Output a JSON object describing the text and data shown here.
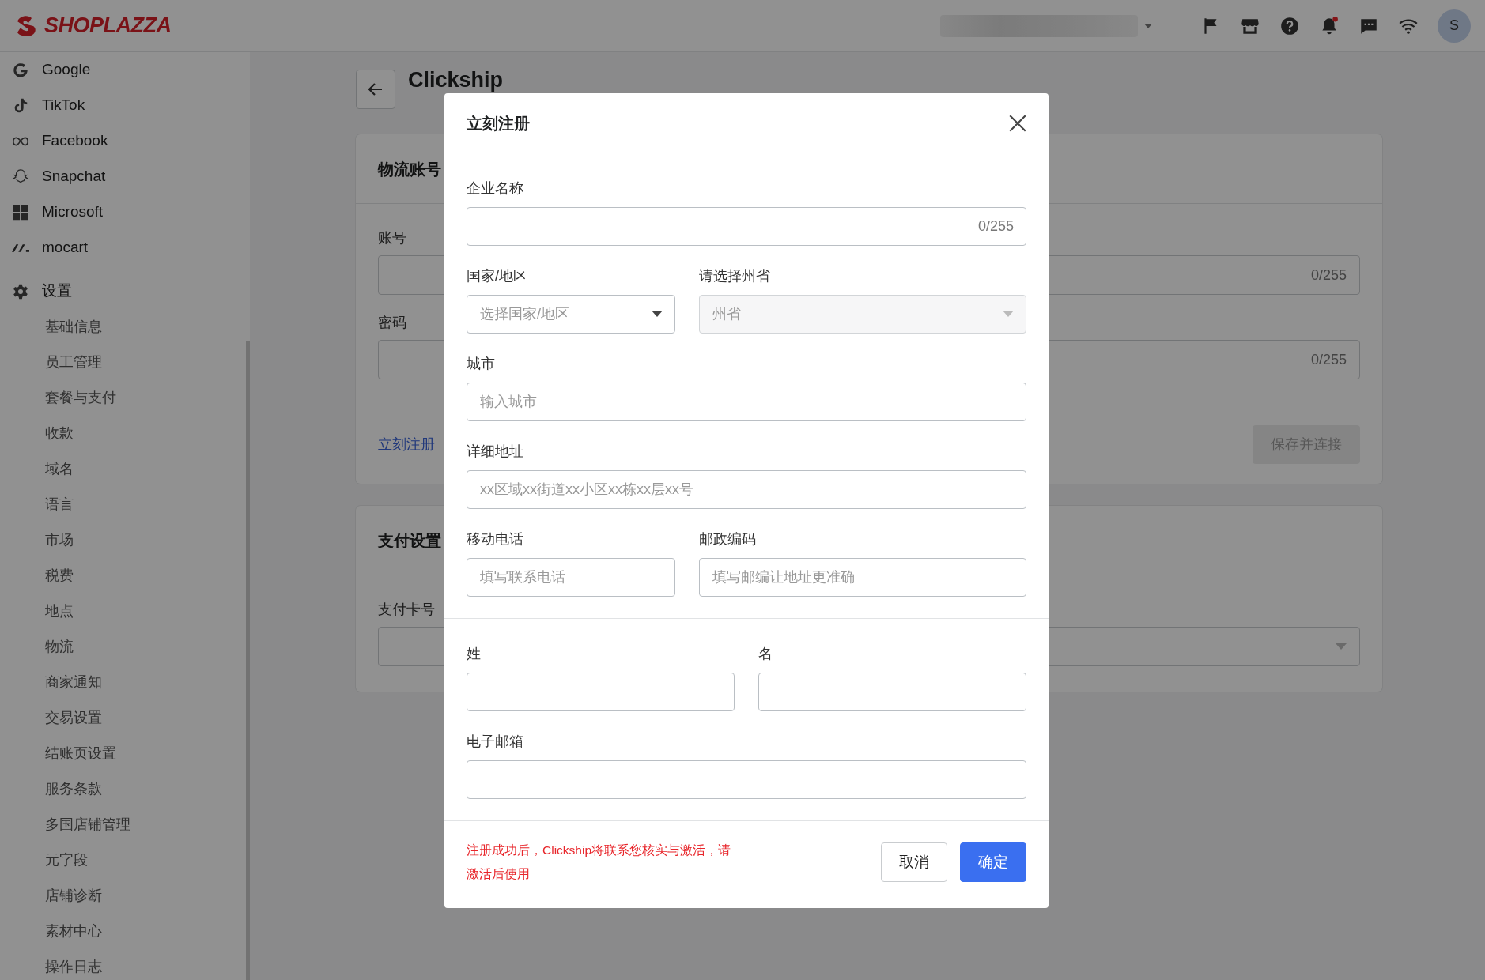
{
  "topbar": {
    "logo": "SHOPLAZZA",
    "avatar": "S"
  },
  "sidebar": {
    "channels": [
      "Google",
      "TikTok",
      "Facebook",
      "Snapchat",
      "Microsoft",
      "mocart"
    ],
    "settings": {
      "label": "设置",
      "children": [
        "基础信息",
        "员工管理",
        "套餐与支付",
        "收款",
        "域名",
        "语言",
        "市场",
        "税费",
        "地点",
        "物流",
        "商家通知",
        "交易设置",
        "结账页设置",
        "服务条款",
        "多国店铺管理",
        "元字段",
        "店铺诊断",
        "素材中心",
        "操作日志"
      ]
    }
  },
  "page": {
    "title": "Clickship",
    "cards": [
      {
        "title": "物流账号",
        "fields": [
          {
            "label": "账号",
            "kind": "text",
            "counter": "0/255"
          },
          {
            "label": "密码",
            "kind": "text",
            "counter": "0/255"
          }
        ],
        "link": "立刻注册",
        "button": "保存并连接"
      },
      {
        "title": "支付设置",
        "fields": [
          {
            "label": "支付卡号",
            "kind": "select"
          }
        ]
      }
    ]
  },
  "modal": {
    "title": "立刻注册",
    "sections": [
      {
        "rows": [
          [
            {
              "label": "企业名称",
              "kind": "text",
              "counter": "0/255",
              "disabled": false
            }
          ],
          [
            {
              "label": "国家/地区",
              "kind": "select",
              "placeholder": "选择国家/地区",
              "disabled": false
            },
            {
              "label": "请选择州省",
              "kind": "select",
              "placeholder": "州省",
              "disabled": true
            }
          ],
          [
            {
              "label": "城市",
              "kind": "text",
              "placeholder": "输入城市",
              "disabled": false
            }
          ],
          [
            {
              "label": "详细地址",
              "kind": "text",
              "placeholder": "xx区域xx街道xx小区xx栋xx层xx号",
              "disabled": false
            }
          ],
          [
            {
              "label": "移动电话",
              "kind": "text",
              "placeholder": "填写联系电话",
              "disabled": false
            },
            {
              "label": "邮政编码",
              "kind": "text",
              "placeholder": "填写邮编让地址更准确",
              "disabled": false
            }
          ]
        ]
      },
      {
        "rows": [
          [
            {
              "label": "姓",
              "kind": "text",
              "disabled": false
            },
            {
              "label": "名",
              "kind": "text",
              "disabled": false
            }
          ],
          [
            {
              "label": "电子邮箱",
              "kind": "text",
              "disabled": false
            }
          ]
        ]
      }
    ],
    "notice": "注册成功后，Clickship将联系您核实与激活，请激活后使用",
    "buttons": [
      {
        "label": "取消",
        "kind": "secondary"
      },
      {
        "label": "确定",
        "kind": "primary"
      }
    ]
  }
}
